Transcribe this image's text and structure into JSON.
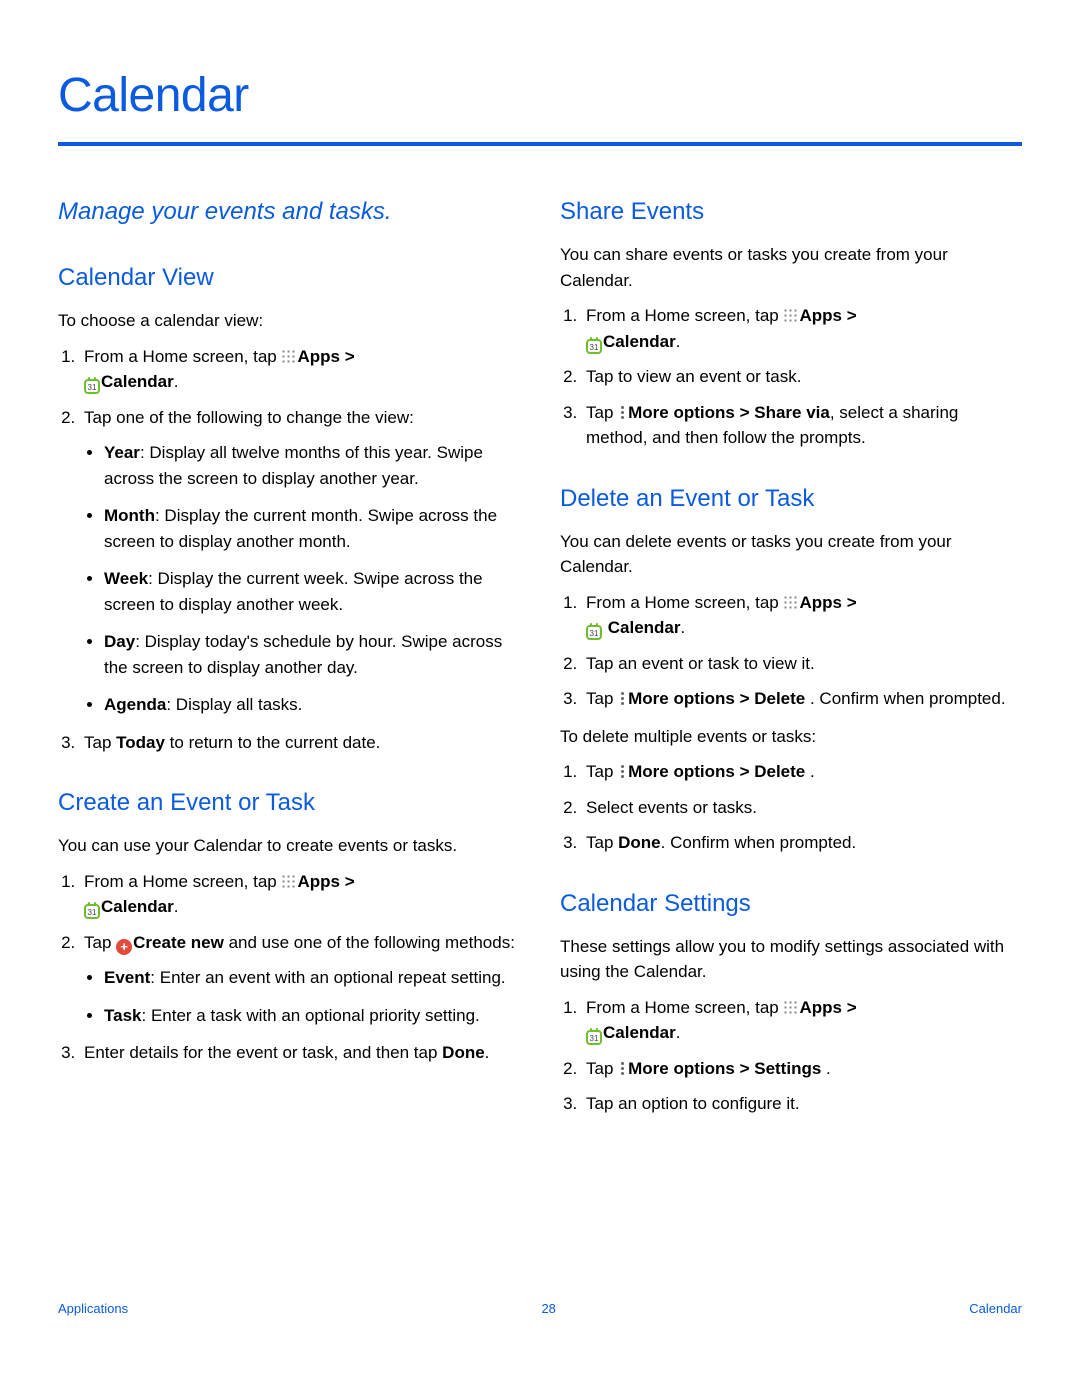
{
  "page": {
    "title": "Calendar",
    "subtitle": "Manage your events and tasks."
  },
  "icons": {
    "calendar_number": "31",
    "plus": "+"
  },
  "left": {
    "calendarView": {
      "heading": "Calendar View",
      "intro": "To choose a calendar view:",
      "step1a": "From a Home screen, tap ",
      "apps": "Apps",
      "gt": " > ",
      "calendar": "Calendar",
      "step2": "Tap one of the following to change the view:",
      "bullets": {
        "year_b": "Year",
        "year_t": ": Display all twelve months of this year. Swipe across the screen to display another year.",
        "month_b": "Month",
        "month_t": ": Display the current month. Swipe across the screen to display another month.",
        "week_b": "Week",
        "week_t": ": Display the current week. Swipe across the screen to display another week.",
        "day_b": "Day",
        "day_t": ": Display today's schedule by hour. Swipe across the screen to display another day.",
        "agenda_b": "Agenda",
        "agenda_t": ": Display all tasks."
      },
      "step3a": "Tap ",
      "step3b": "Today",
      "step3c": " to return to the current date."
    },
    "create": {
      "heading": "Create an Event or Task",
      "intro": "You can use your Calendar to create events or tasks.",
      "step1a": "From a Home screen, tap ",
      "apps": "Apps",
      "gt": " > ",
      "calendar": "Calendar",
      "step2a": "Tap ",
      "step2b": "Create new",
      "step2c": " and use one of the following methods:",
      "bullets": {
        "event_b": "Event",
        "event_t": ": Enter an event with an optional repeat setting.",
        "task_b": "Task",
        "task_t": ": Enter a task with an optional priority setting."
      },
      "step3a": "Enter details for the event or task, and then tap ",
      "step3b": "Done",
      "step3c": "."
    }
  },
  "right": {
    "share": {
      "heading": "Share Events",
      "intro": "You can share events or tasks you create from your Calendar.",
      "step1a": "From a Home screen, tap ",
      "apps": "Apps",
      "gt": " > ",
      "calendar": "Calendar",
      "step2": "Tap to view an event or task.",
      "step3a": "Tap ",
      "step3b": "More options > Share via",
      "step3c": ", select a sharing method, and then follow the prompts."
    },
    "delete": {
      "heading": "Delete an Event or Task",
      "intro": "You can delete events or tasks you create from your Calendar.",
      "step1a": "From a Home screen, tap ",
      "apps": "Apps",
      "gt": " > ",
      "calendar": "Calendar",
      "step2": "Tap an event or task to view it.",
      "step3a": "Tap ",
      "step3b": "More options > Delete ",
      "step3c": ". Confirm when prompted.",
      "intro2": "To delete multiple events or tasks:",
      "m1a": "Tap ",
      "m1b": "More options > Delete ",
      "m1c": ".",
      "m2": "Select events or tasks.",
      "m3a": "Tap ",
      "m3b": "Done",
      "m3c": ". Confirm when prompted."
    },
    "settings": {
      "heading": "Calendar Settings",
      "intro": "These settings allow you to modify settings associated with using the Calendar.",
      "step1a": "From a Home screen, tap ",
      "apps": "Apps",
      "gt": " > ",
      "calendar": "Calendar",
      "step2a": "Tap ",
      "step2b": "More options > Settings ",
      "step2c": ".",
      "step3": "Tap an option to configure it."
    }
  },
  "footer": {
    "left": "Applications",
    "center": "28",
    "right": "Calendar"
  }
}
